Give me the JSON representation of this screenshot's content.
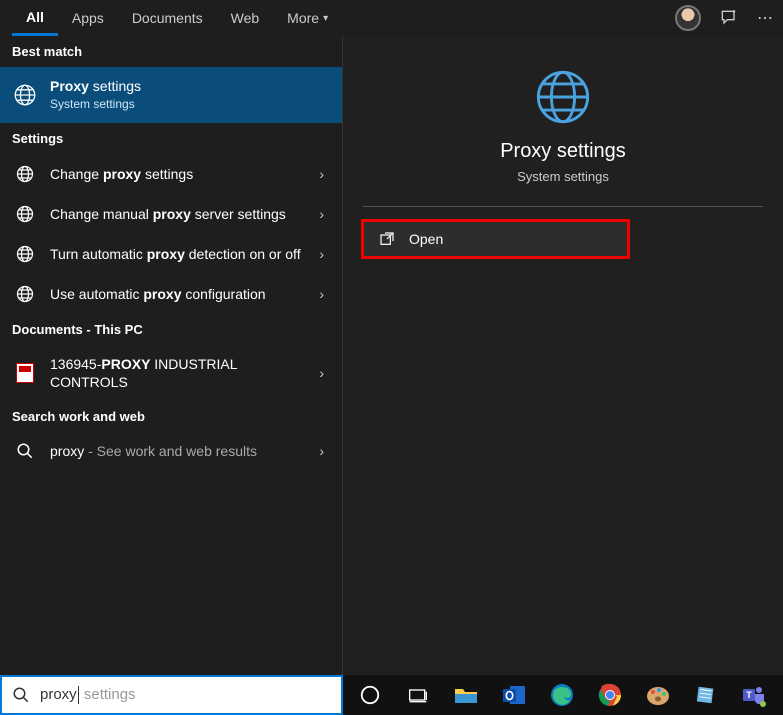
{
  "tabs": {
    "all": "All",
    "apps": "Apps",
    "documents": "Documents",
    "web": "Web",
    "more": "More"
  },
  "headers": {
    "best": "Best match",
    "settings": "Settings",
    "docs": "Documents - This PC",
    "web": "Search work and web"
  },
  "best": {
    "title_bold": "Proxy",
    "title_rest": " settings",
    "sub": "System settings"
  },
  "settings_items": [
    {
      "pre": "Change ",
      "b": "proxy",
      "post": " settings"
    },
    {
      "pre": "Change manual ",
      "b": "proxy",
      "post": " server settings"
    },
    {
      "pre": "Turn automatic ",
      "b": "proxy",
      "post": " detection on or off"
    },
    {
      "pre": "Use automatic ",
      "b": "proxy",
      "post": " configuration"
    }
  ],
  "doc_item": {
    "pre": "136945-",
    "b": "PROXY",
    "post": " INDUSTRIAL CONTROLS"
  },
  "web_item": {
    "term": "proxy",
    "suffix": " - See work and web results"
  },
  "preview": {
    "title": "Proxy settings",
    "sub": "System settings"
  },
  "action_open": "Open",
  "search_typed": "proxy",
  "search_ghost": " settings"
}
